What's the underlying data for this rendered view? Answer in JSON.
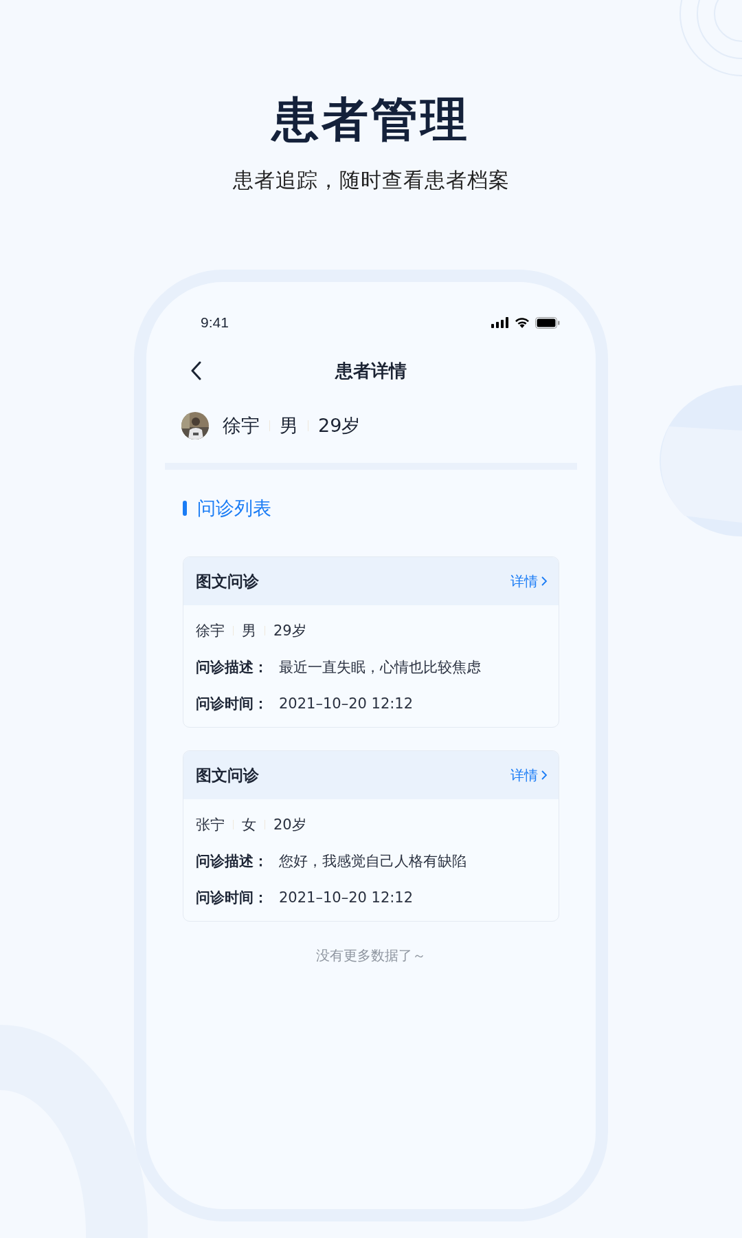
{
  "header": {
    "title": "患者管理",
    "subtitle": "患者追踪，随时查看患者档案"
  },
  "phone": {
    "status_bar": {
      "time": "9:41"
    },
    "nav": {
      "title": "患者详情"
    },
    "patient": {
      "name": "徐宇",
      "gender": "男",
      "age": "29岁"
    },
    "section_title": "问诊列表",
    "consultations": [
      {
        "type": "图文问诊",
        "detail_link": "详情",
        "name": "徐宇",
        "gender": "男",
        "age": "29岁",
        "description_label": "问诊描述：",
        "description": "最近一直失眠，心情也比较焦虑",
        "time_label": "问诊时间：",
        "time": "2021–10–20 12:12"
      },
      {
        "type": "图文问诊",
        "detail_link": "详情",
        "name": "张宁",
        "gender": "女",
        "age": "20岁",
        "description_label": "问诊描述：",
        "description": "您好，我感觉自己人格有缺陷",
        "time_label": "问诊时间：",
        "time": "2021–10–20 12:12"
      }
    ],
    "footer": "没有更多数据了～"
  }
}
